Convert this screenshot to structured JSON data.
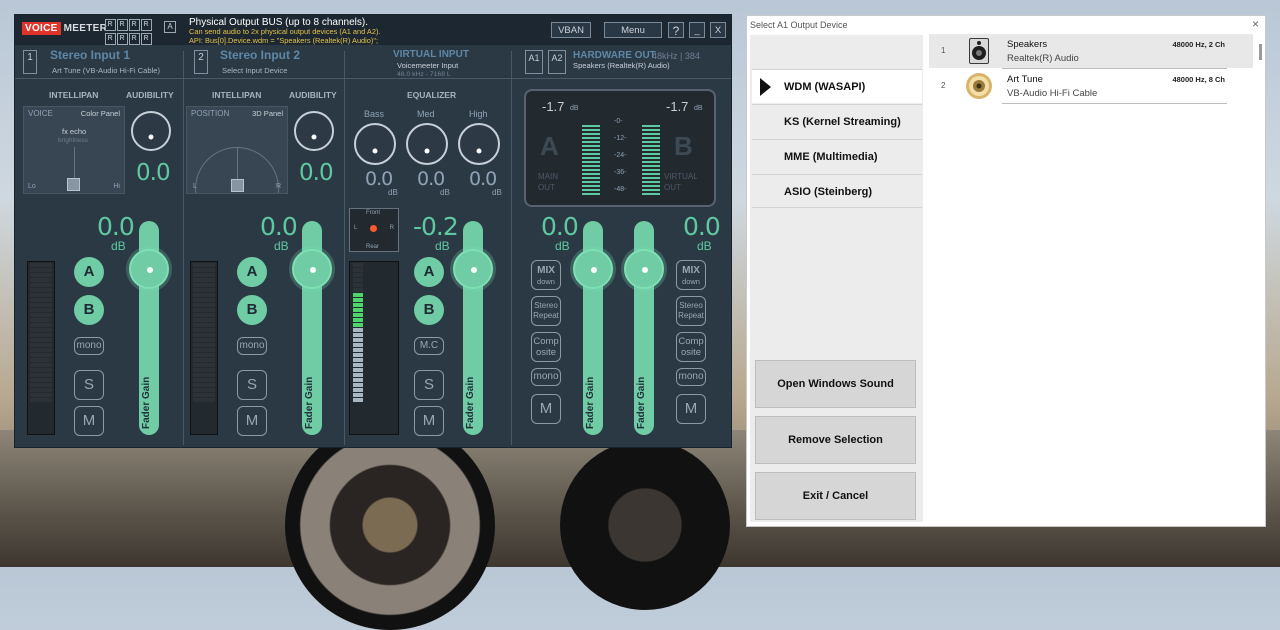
{
  "voicemeeter": {
    "logo_voice": "VOICE",
    "logo_meeter": "MEETER",
    "rrr": [
      "R",
      "R",
      "R",
      "R",
      "R",
      "R",
      "R",
      "R"
    ],
    "a_badge": "A",
    "bus_title": "Physical Output BUS (up to 8 channels).",
    "bus_desc_1": "Can send audio to 2x physical output devices (A1 and A2).",
    "bus_desc_2": "API: Bus[0].Device.wdm = \"Speakers (Realtek(R) Audio)\";",
    "vban": "VBAN",
    "menu": "Menu",
    "help": "?",
    "minimize": "_",
    "close": "X",
    "strip1": {
      "num": "1",
      "name": "Stereo Input 1",
      "device": "Art Tune (VB-Audio Hi-Fi Cable)",
      "intellipan": "INTELLIPAN",
      "audibility": "AUDIBILITY",
      "voice": "VOICE",
      "color_panel": "Color Panel",
      "fx_echo": "fx echo",
      "brightness": "brightness",
      "lo": "Lo",
      "hi": "Hi",
      "aud_val": "0.0",
      "gain": "0.0",
      "db": "dB",
      "a": "A",
      "b": "B",
      "mono": "mono",
      "s": "S",
      "m": "M",
      "fader_label": "Fader Gain"
    },
    "strip2": {
      "num": "2",
      "name": "Stereo Input 2",
      "device": "Select Input Device",
      "intellipan": "INTELLIPAN",
      "audibility": "AUDIBILITY",
      "position": "POSITION",
      "panel3d": "3D Panel",
      "l": "L",
      "r": "R",
      "aud_val": "0.0",
      "gain": "0.0",
      "db": "dB",
      "a": "A",
      "b": "B",
      "mono": "mono",
      "s": "S",
      "m": "M",
      "fader_label": "Fader Gain"
    },
    "virtual": {
      "name": "VIRTUAL INPUT",
      "device": "Voicemeeter Input",
      "rate": "48.0 kHz - 7168 L",
      "equalizer": "EQUALIZER",
      "bass": "Bass",
      "med": "Med",
      "high": "High",
      "bass_val": "0.0",
      "med_val": "0.0",
      "high_val": "0.0",
      "eq_db": "dB",
      "front": "Front",
      "rear": "Rear",
      "l": "L",
      "r": "R",
      "gain": "-0.2",
      "db": "dB",
      "a": "A",
      "b": "B",
      "mc": "M.C",
      "s": "S",
      "m": "M",
      "fader_label": "Fader Gain"
    },
    "hardware": {
      "a1": "A1",
      "a2": "A2",
      "name": "HARDWARE OUT",
      "rate": "48kHz | 384",
      "device": "Speakers (Realtek(R) Audio)",
      "left_db": "-1.7",
      "right_db": "-1.7",
      "db_unit": "dB",
      "big_a": "A",
      "big_b": "B",
      "main_out": "MAIN\nOUT",
      "virtual_out": "VIRTUAL\nOUT",
      "scale": [
        "-0-",
        "-12-",
        "-24-",
        "-36-",
        "-48-"
      ]
    },
    "bus_a": {
      "gain": "0.0",
      "db": "dB",
      "mix": "MIX",
      "down": "down",
      "stereo_repeat": "Stereo Repeat",
      "composite": "Comp osite",
      "mono": "mono",
      "m": "M",
      "fader_label": "Fader Gain"
    },
    "bus_b": {
      "gain": "0.0",
      "db": "dB",
      "mix": "MIX",
      "down": "down",
      "stereo_repeat": "Stereo Repeat",
      "composite": "Comp osite",
      "mono": "mono",
      "m": "M",
      "fader_label": "Fader Gain"
    }
  },
  "dialog": {
    "title": "Select A1 Output Device",
    "close": "×",
    "apis": [
      {
        "label": "WDM (WASAPI)",
        "selected": true
      },
      {
        "label": "KS (Kernel Streaming)",
        "selected": false
      },
      {
        "label": "MME (Multimedia)",
        "selected": false
      },
      {
        "label": "ASIO (Steinberg)",
        "selected": false
      }
    ],
    "actions": [
      "Open Windows Sound",
      "Remove Selection",
      "Exit / Cancel"
    ],
    "devices": [
      {
        "index": "1",
        "name": "Speakers",
        "sub": "Realtek(R) Audio",
        "hz": "48000 Hz, 2 Ch",
        "icon": "speaker-icon"
      },
      {
        "index": "2",
        "name": "Art Tune",
        "sub": "VB-Audio Hi-Fi Cable",
        "hz": "48000 Hz, 8 Ch",
        "icon": "cable-icon"
      }
    ]
  }
}
